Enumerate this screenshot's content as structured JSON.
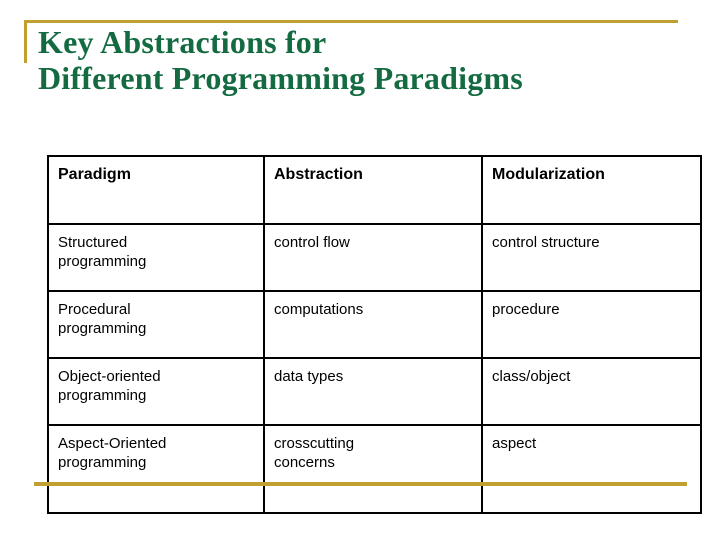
{
  "slide": {
    "title": "Key Abstractions for\nDifferent Programming Paradigms",
    "title_color": "#146b42",
    "accent_color": "#bfa030",
    "border_color": "#000000",
    "background_color": "#ffffff"
  },
  "table": {
    "headers": [
      "Paradigm",
      "Abstraction",
      "Modularization"
    ],
    "rows": [
      {
        "paradigm_line1": "Structured",
        "paradigm_line2": "programming",
        "abstraction_line1": "control flow",
        "abstraction_line2": "",
        "modularization_line1": "control structure",
        "modularization_line2": ""
      },
      {
        "paradigm_line1": "Procedural",
        "paradigm_line2": "programming",
        "abstraction_line1": "computations",
        "abstraction_line2": "",
        "modularization_line1": "procedure",
        "modularization_line2": ""
      },
      {
        "paradigm_line1": "Object-oriented",
        "paradigm_line2": "programming",
        "abstraction_line1": "data types",
        "abstraction_line2": "",
        "modularization_line1": "class/object",
        "modularization_line2": ""
      },
      {
        "paradigm_line1": "Aspect-Oriented",
        "paradigm_line2": "programming",
        "abstraction_line1": "crosscutting",
        "abstraction_line2": "concerns",
        "modularization_line1": "aspect",
        "modularization_line2": ""
      }
    ]
  }
}
